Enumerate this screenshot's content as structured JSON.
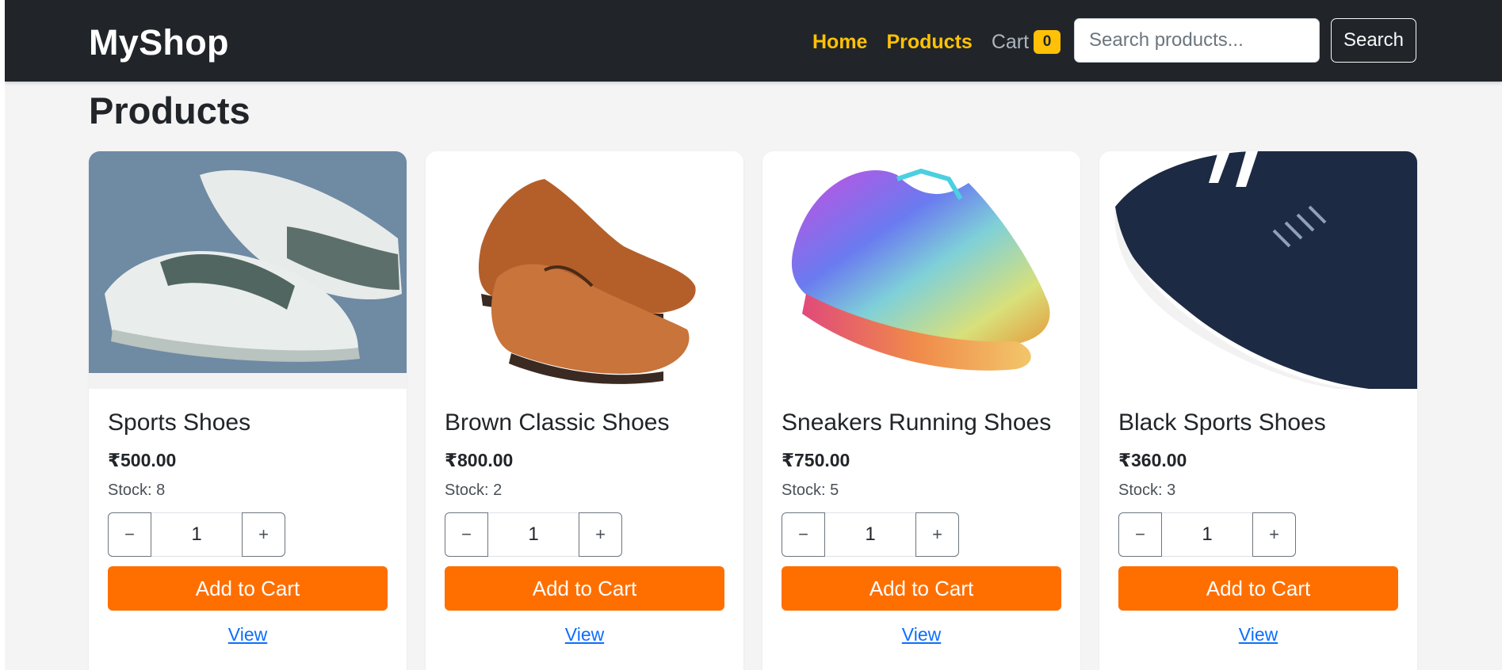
{
  "navbar": {
    "brand": "MyShop",
    "links": [
      {
        "label": "Home"
      },
      {
        "label": "Products"
      },
      {
        "label": "Cart"
      }
    ],
    "cart_count": "0",
    "search_placeholder": "Search products...",
    "search_button": "Search"
  },
  "page": {
    "title": "Products"
  },
  "products": [
    {
      "name": "Sports Shoes",
      "price": "₹500.00",
      "stock": "Stock: 8",
      "qty": "1",
      "add_label": "Add to Cart",
      "view_label": "View"
    },
    {
      "name": "Brown Classic Shoes",
      "price": "₹800.00",
      "stock": "Stock: 2",
      "qty": "1",
      "add_label": "Add to Cart",
      "view_label": "View"
    },
    {
      "name": "Sneakers Running Shoes",
      "price": "₹750.00",
      "stock": "Stock: 5",
      "qty": "1",
      "add_label": "Add to Cart",
      "view_label": "View"
    },
    {
      "name": "Black Sports Shoes",
      "price": "₹360.00",
      "stock": "Stock: 3",
      "qty": "1",
      "add_label": "Add to Cart",
      "view_label": "View"
    }
  ],
  "qty_controls": {
    "minus": "−",
    "plus": "+"
  },
  "colors": {
    "navbar_bg": "#212529",
    "accent_yellow": "#ffc107",
    "add_to_cart": "#ff6f00",
    "link_blue": "#0d6efd",
    "page_bg": "#f4f4f4"
  }
}
